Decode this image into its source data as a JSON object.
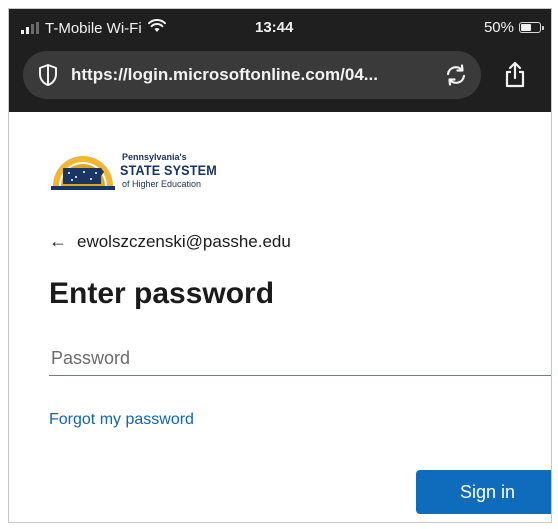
{
  "status_bar": {
    "carrier": "T-Mobile Wi-Fi",
    "time": "13:44",
    "battery": "50%",
    "battery_level": 0.5
  },
  "browser": {
    "url": "https://login.microsoftonline.com/04..."
  },
  "logo": {
    "line1": "Pennsylvania's",
    "line2": "STATE SYSTEM",
    "line3": "of Higher Education"
  },
  "login": {
    "account": "ewolszczenski@passhe.edu",
    "title": "Enter password",
    "password_placeholder": "Password",
    "forgot_link": "Forgot my password",
    "sign_in": "Sign in"
  },
  "colors": {
    "topbar_bg": "#1f1f1f",
    "url_pill_bg": "#3a3a3a",
    "link": "#0f64b8",
    "primary_button": "#0f6cbd",
    "input_underline": "#4a86c6"
  },
  "icons": [
    "wifi-icon",
    "signal-icon",
    "battery-icon",
    "shield-icon",
    "reload-icon",
    "share-icon",
    "back-arrow-icon"
  ]
}
